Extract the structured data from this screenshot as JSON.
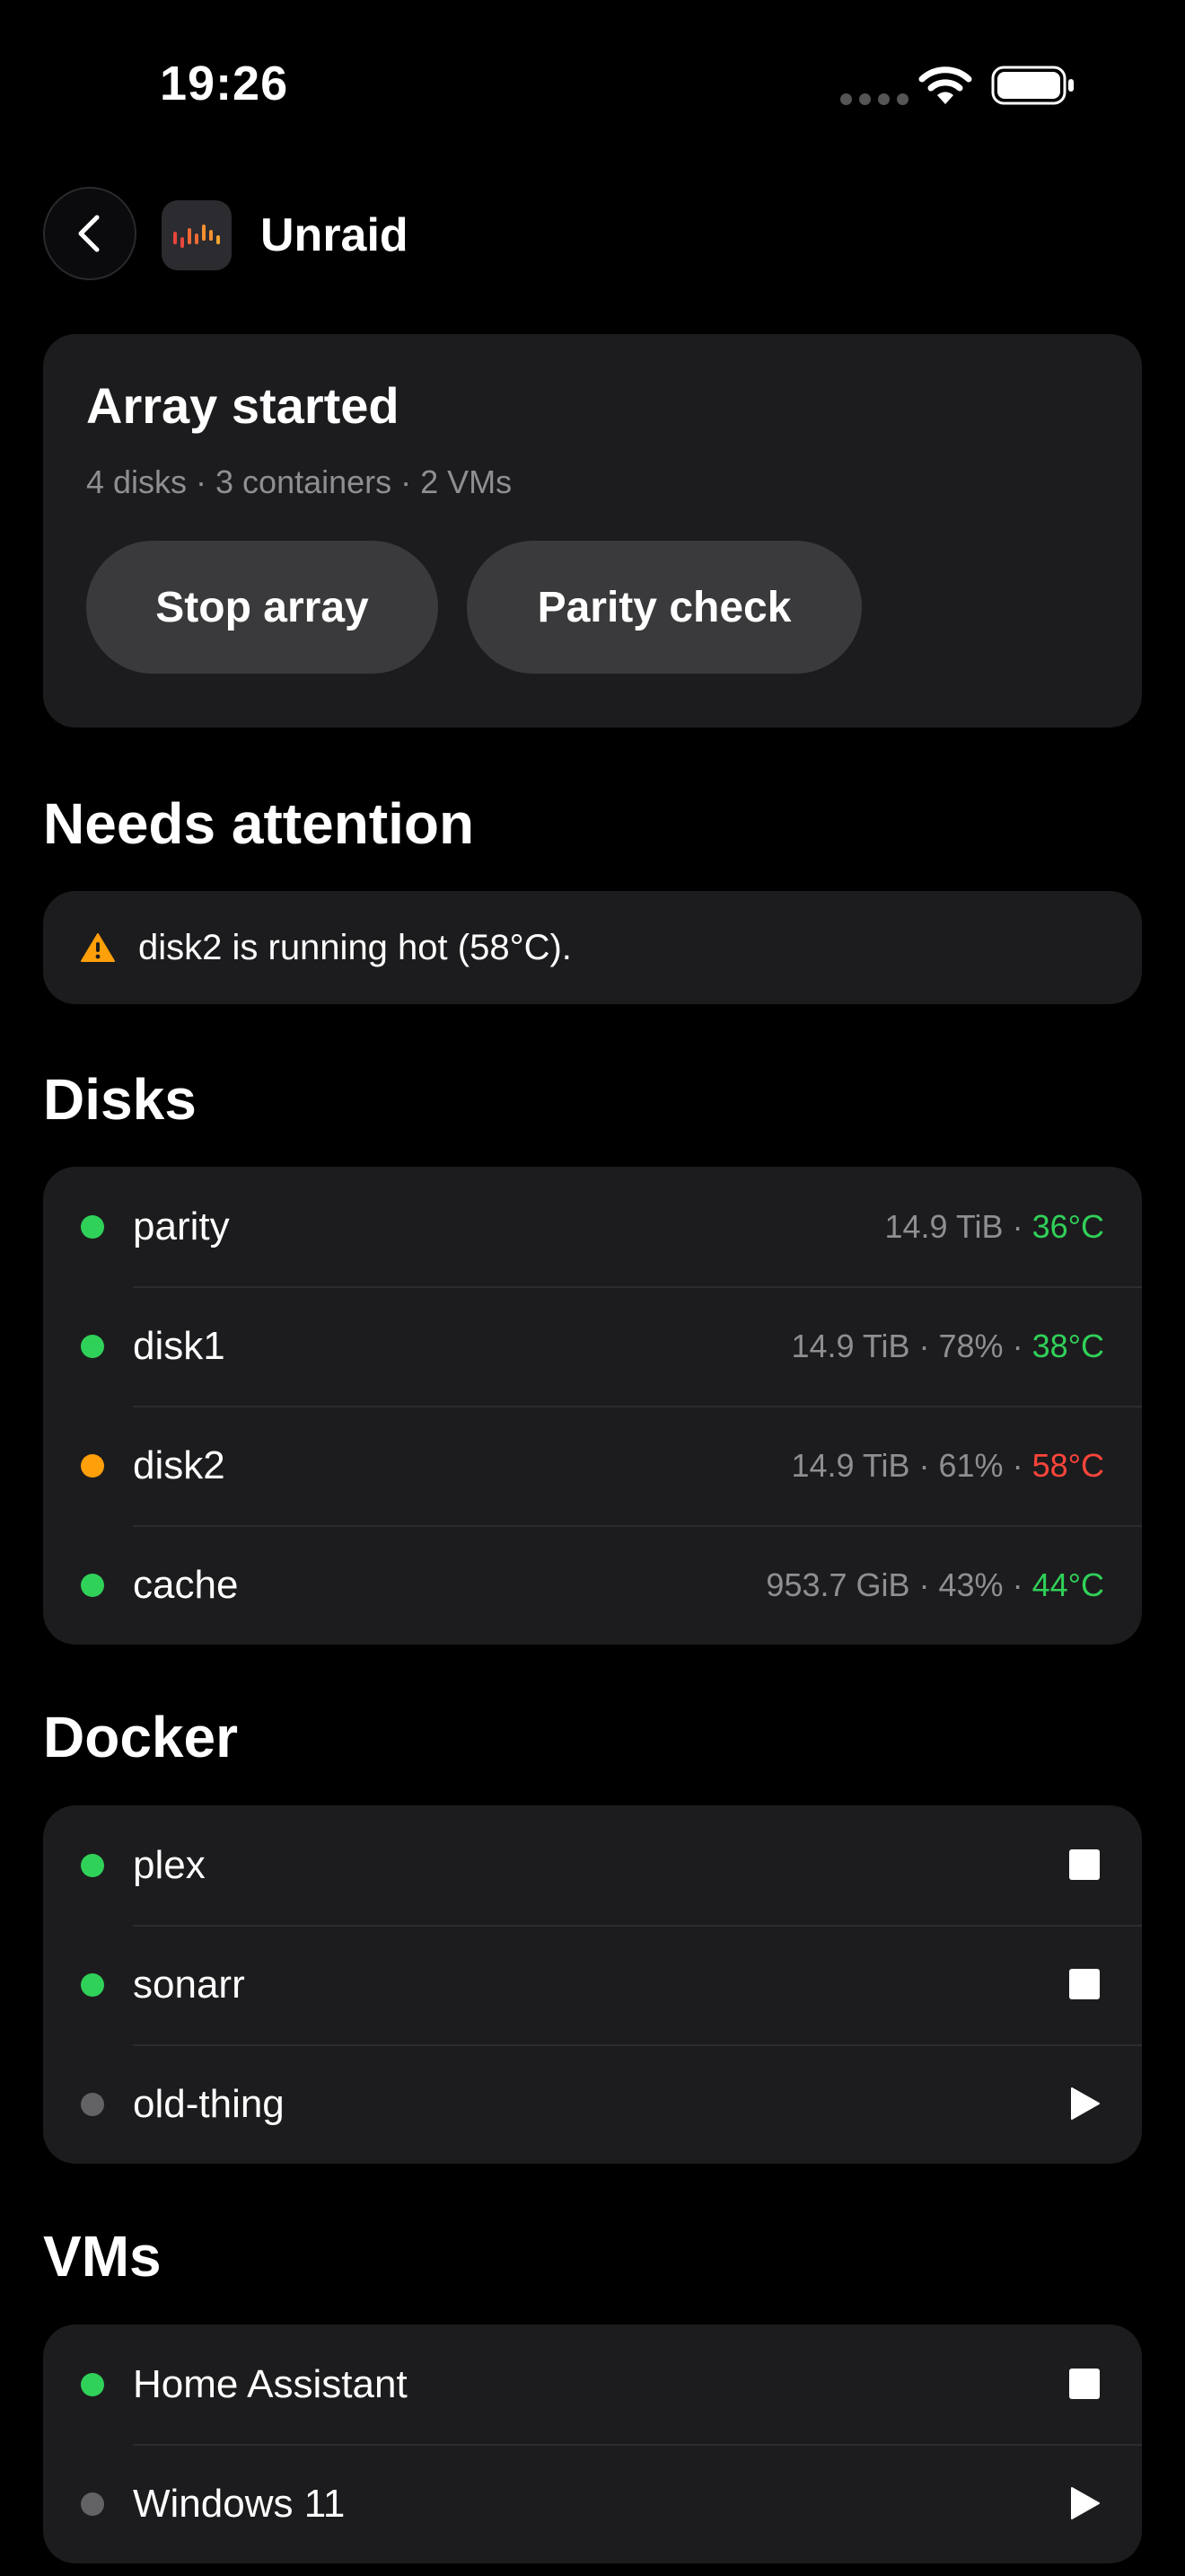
{
  "status_bar": {
    "time": "19:26"
  },
  "header": {
    "title": "Unraid"
  },
  "array": {
    "title": "Array started",
    "subtitle": "4 disks · 3 containers · 2 VMs",
    "stop_label": "Stop array",
    "parity_label": "Parity check"
  },
  "attention": {
    "title": "Needs attention",
    "message": "disk2 is running hot (58°C)."
  },
  "disks": {
    "title": "Disks",
    "items": [
      {
        "name": "parity",
        "meta": "14.9 TiB · ",
        "temp": "36°C",
        "status": "ok"
      },
      {
        "name": "disk1",
        "meta": "14.9 TiB · 78% · ",
        "temp": "38°C",
        "status": "ok"
      },
      {
        "name": "disk2",
        "meta": "14.9 TiB · 61% · ",
        "temp": "58°C",
        "status": "warning"
      },
      {
        "name": "cache",
        "meta": "953.7 GiB · 43% · ",
        "temp": "44°C",
        "status": "ok"
      }
    ]
  },
  "docker": {
    "title": "Docker",
    "items": [
      {
        "name": "plex",
        "state": "running",
        "action_icon": "stop-icon"
      },
      {
        "name": "sonarr",
        "state": "running",
        "action_icon": "stop-icon"
      },
      {
        "name": "old-thing",
        "state": "stopped",
        "action_icon": "play-icon"
      }
    ]
  },
  "vms": {
    "title": "VMs",
    "items": [
      {
        "name": "Home Assistant",
        "state": "running",
        "action_icon": "stop-icon"
      },
      {
        "name": "Windows 11",
        "state": "stopped",
        "action_icon": "play-icon"
      }
    ]
  },
  "colors": {
    "background": "#000000",
    "card": "#1c1c1e",
    "button": "#3a3a3c",
    "ok_green": "#30d158",
    "warning_orange": "#ff9f0a",
    "hot_red": "#ff453a",
    "stopped_gray": "#636366",
    "muted_text": "#8e8e93"
  }
}
